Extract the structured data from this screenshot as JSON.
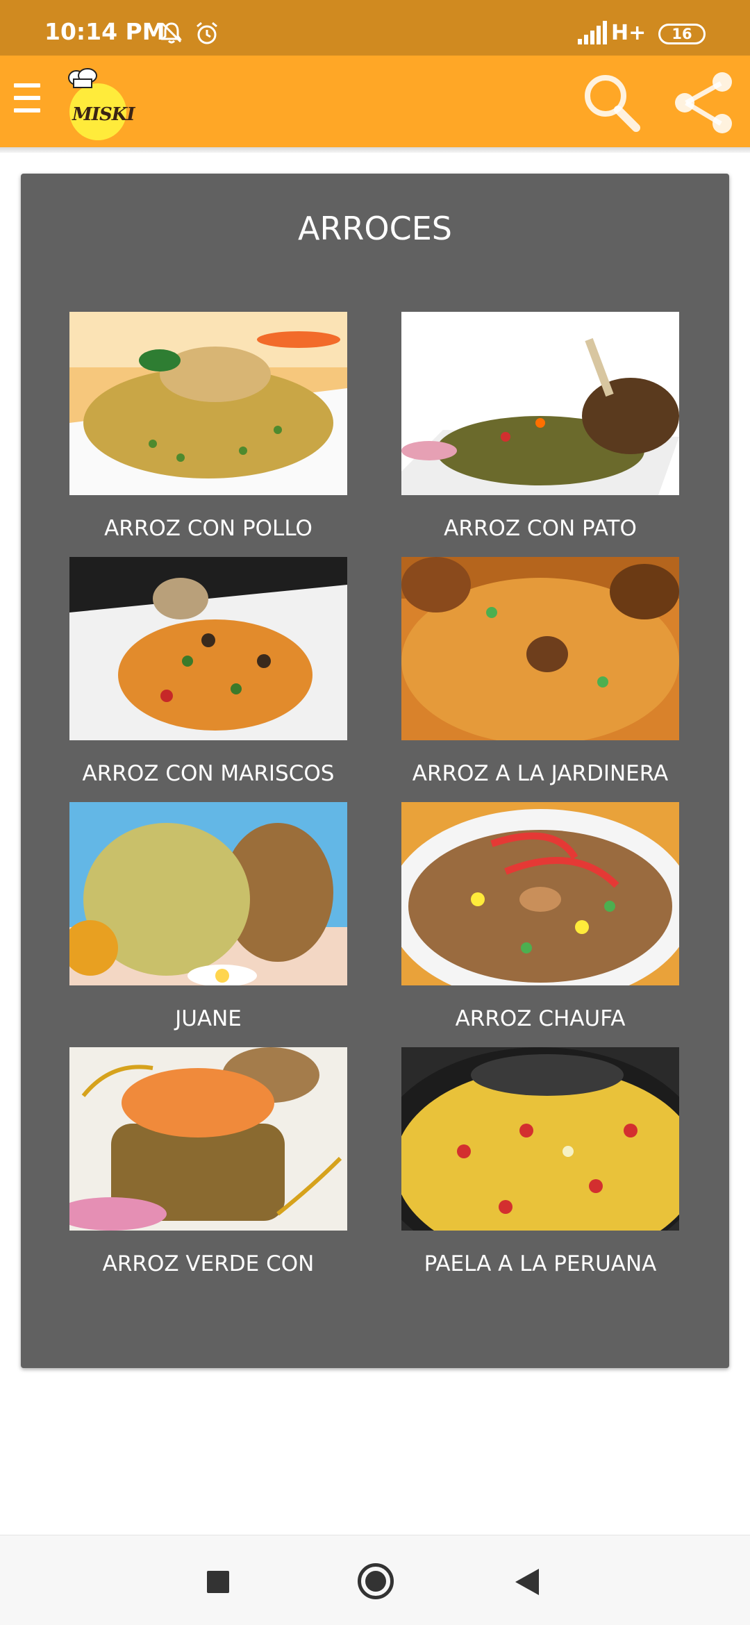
{
  "status_bar": {
    "time": "10:14 PM",
    "network": "H+",
    "battery": "16",
    "icons": [
      "bell-off-icon",
      "alarm-icon",
      "signal-icon",
      "battery-icon"
    ]
  },
  "app_bar": {
    "logo_text": "MISKI",
    "icons": [
      "menu-icon",
      "search-icon",
      "share-icon"
    ],
    "colors": {
      "status_bar": "#d08a20",
      "toolbar": "#ffa726"
    }
  },
  "card": {
    "title": "ARROCES",
    "background": "#616161",
    "items": [
      {
        "label": "ARROZ CON POLLO"
      },
      {
        "label": "ARROZ CON PATO"
      },
      {
        "label": "ARROZ CON MARISCOS"
      },
      {
        "label": "ARROZ A LA JARDINERA"
      },
      {
        "label": "JUANE"
      },
      {
        "label": "ARROZ CHAUFA"
      },
      {
        "label": "ARROZ VERDE CON"
      },
      {
        "label": "PAELA A LA PERUANA"
      }
    ]
  },
  "nav_bar": {
    "icons": [
      "recents-square-icon",
      "home-circle-icon",
      "back-triangle-icon"
    ]
  }
}
